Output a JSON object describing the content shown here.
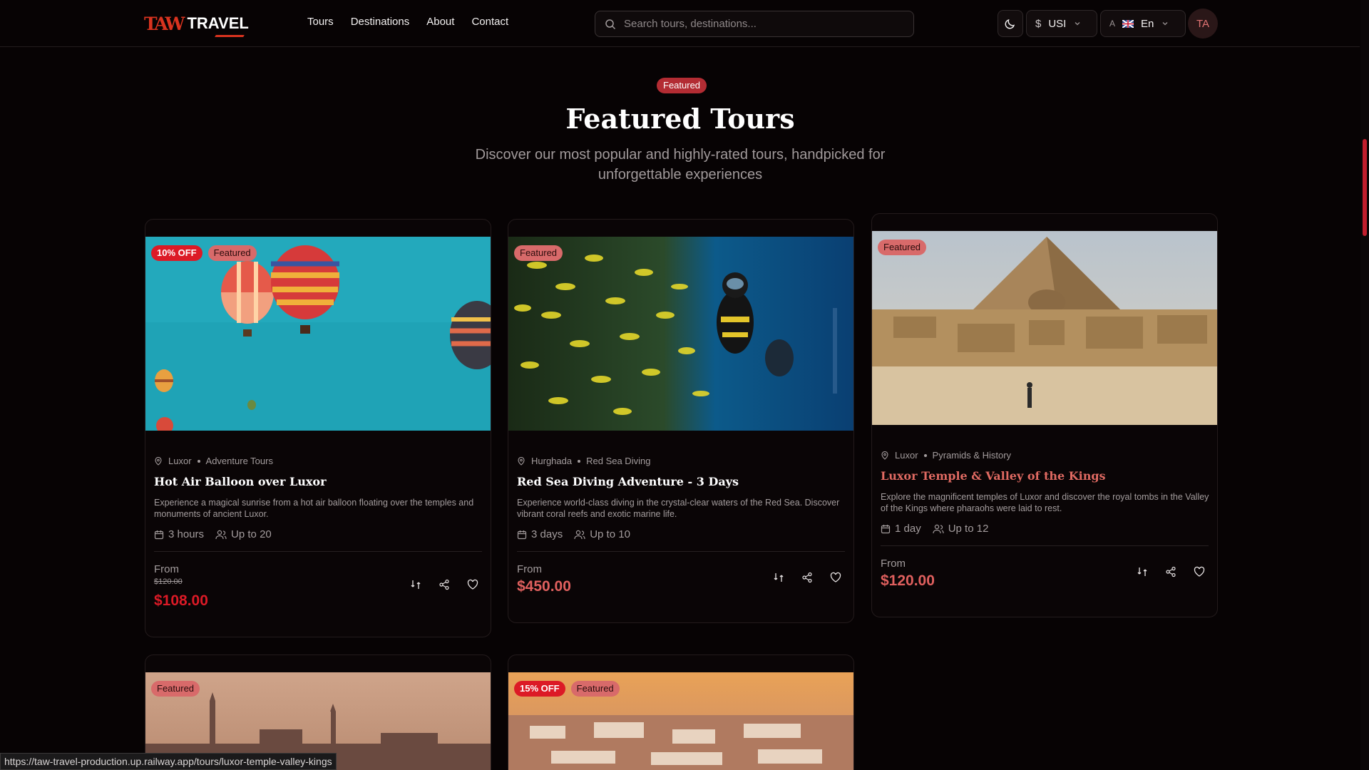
{
  "header": {
    "logo_mark": "TAW",
    "logo_text": "TRAVEL",
    "nav": [
      "Tours",
      "Destinations",
      "About",
      "Contact"
    ],
    "search_placeholder": "Search tours, destinations...",
    "currency": "USI",
    "language": "En",
    "avatar_initials": "TA"
  },
  "section": {
    "badge": "Featured",
    "title": "Featured Tours",
    "subtitle": "Discover our most popular and highly-rated tours, handpicked for unforgettable experiences"
  },
  "cards": [
    {
      "discount": "10% OFF",
      "badge": "Featured",
      "location": "Luxor",
      "category": "Adventure Tours",
      "title": "Hot Air Balloon over Luxor",
      "description": "Experience a magical sunrise from a hot air balloon floating over the temples and monuments of ancient Luxor.",
      "duration": "3 hours",
      "group": "Up to 20",
      "from_label": "From",
      "old_price": "$120.00",
      "price": "$108.00"
    },
    {
      "badge": "Featured",
      "location": "Hurghada",
      "category": "Red Sea Diving",
      "title": "Red Sea Diving Adventure - 3 Days",
      "description": "Experience world-class diving in the crystal-clear waters of the Red Sea. Discover vibrant coral reefs and exotic marine life.",
      "duration": "3 days",
      "group": "Up to 10",
      "from_label": "From",
      "price": "$450.00"
    },
    {
      "badge": "Featured",
      "location": "Luxor",
      "category": "Pyramids & History",
      "title": "Luxor Temple & Valley of the Kings",
      "description": "Explore the magnificent temples of Luxor and discover the royal tombs in the Valley of the Kings where pharaohs were laid to rest.",
      "duration": "1 day",
      "group": "Up to 12",
      "from_label": "From",
      "price": "$120.00"
    },
    {
      "badge": "Featured"
    },
    {
      "discount": "15% OFF",
      "badge": "Featured"
    }
  ],
  "status_url": "https://taw-travel-production.up.railway.app/tours/luxor-temple-valley-kings",
  "colors": {
    "accent": "#dc1a26",
    "background": "#070304",
    "card": "#0a0506"
  }
}
